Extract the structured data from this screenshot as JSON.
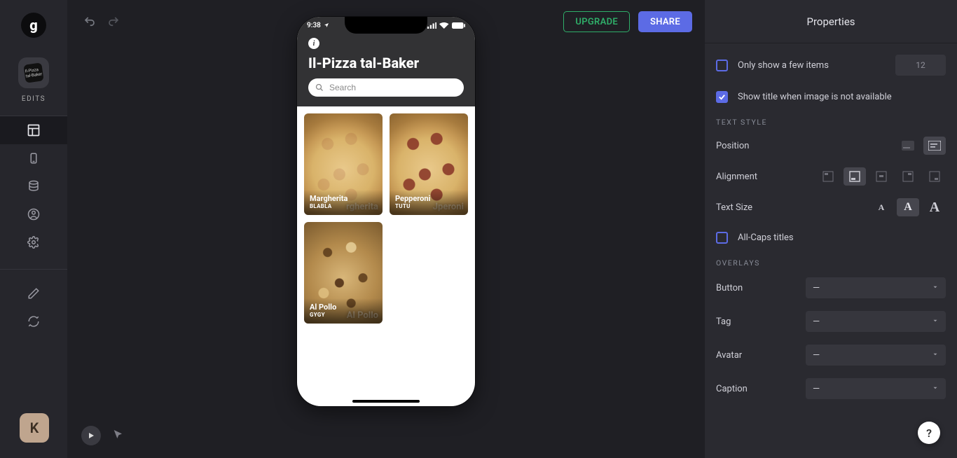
{
  "rail": {
    "logo": "g",
    "edits_label": "EDITS",
    "user_initial": "K"
  },
  "topbar": {
    "upgrade": "UPGRADE",
    "share": "SHARE"
  },
  "phone": {
    "time": "9:38",
    "app_title": "Il-Pizza tal-Baker",
    "search_placeholder": "Search",
    "cards": [
      {
        "title": "Margherita",
        "sub": "BLABLA",
        "wm": "rgherita",
        "variant": "cheese"
      },
      {
        "title": "Pepperoni",
        "sub": "TUTU",
        "wm": "Jperoni",
        "variant": ""
      },
      {
        "title": "Al Pollo",
        "sub": "GYGY",
        "wm": "Al Pollo",
        "variant": "pollo"
      }
    ]
  },
  "props": {
    "title": "Properties",
    "only_show_label": "Only show a few items",
    "only_show_value": "12",
    "show_title_label": "Show title when image is not available",
    "sections": {
      "text_style": "TEXT STYLE",
      "overlays": "OVERLAYS"
    },
    "rows": {
      "position": "Position",
      "alignment": "Alignment",
      "text_size": "Text Size",
      "all_caps": "All-Caps titles",
      "button": "Button",
      "tag": "Tag",
      "avatar": "Avatar",
      "caption": "Caption"
    },
    "dd_none": "—",
    "help": "?"
  }
}
